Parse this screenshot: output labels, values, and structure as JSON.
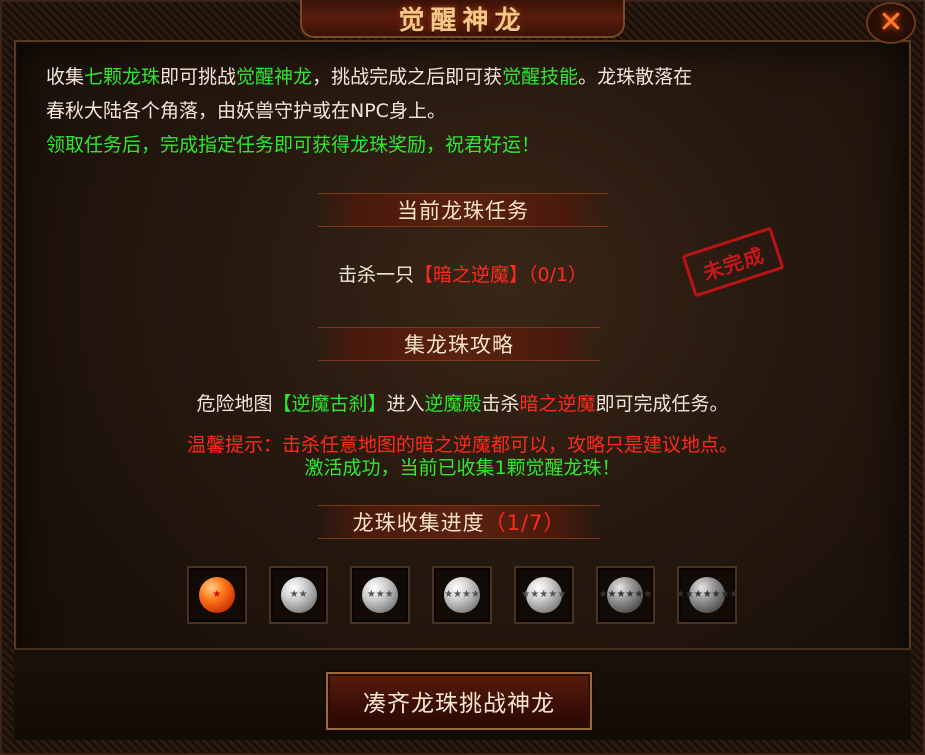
{
  "title": "觉醒神龙",
  "close_icon": "close-icon",
  "intro": {
    "p1": "收集",
    "p2": "七颗龙珠",
    "p3": "即可挑战",
    "p4": "觉醒神龙",
    "p5": "，挑战完成之后即可获",
    "p6": "觉醒技能",
    "p7": "。龙珠散落在",
    "p8": "春秋大陆各个角落，由妖兽守护或在NPC身上。",
    "p9": "领取任务后，完成指定任务即可获得龙珠奖励，祝君好运！"
  },
  "current_task": {
    "header": "当前龙珠任务",
    "prefix": "击杀一只",
    "target": "【暗之逆魔】",
    "progress": "（0/1）",
    "stamp": "未完成"
  },
  "guide": {
    "header": "集龙珠攻略",
    "g1": "危险地图",
    "g2": "【逆魔古刹】",
    "g3": "进入",
    "g4": "逆魔殿",
    "g5": "击杀",
    "g6": "暗之逆魔",
    "g7": "即可完成任务。",
    "tip": "温馨提示：击杀任意地图的暗之逆魔都可以，攻略只是建议地点。",
    "success": "激活成功，当前已收集1颗觉醒龙珠！"
  },
  "collection": {
    "label": "龙珠收集进度",
    "count": "（1/7）",
    "balls": [
      {
        "stars": "★",
        "collected": true
      },
      {
        "stars": "★★",
        "collected": false
      },
      {
        "stars": "★★★",
        "collected": false
      },
      {
        "stars": "★★★★",
        "collected": false
      },
      {
        "stars": "★★★★★",
        "collected": false
      },
      {
        "stars": "★★★★★★",
        "collected": false
      },
      {
        "stars": "★★★★★★★",
        "collected": false
      }
    ]
  },
  "action_button": "凑齐龙珠挑战神龙",
  "colors": {
    "green": "#2ee82e",
    "red": "#ff2a1a",
    "accent": "#f3c98a"
  }
}
